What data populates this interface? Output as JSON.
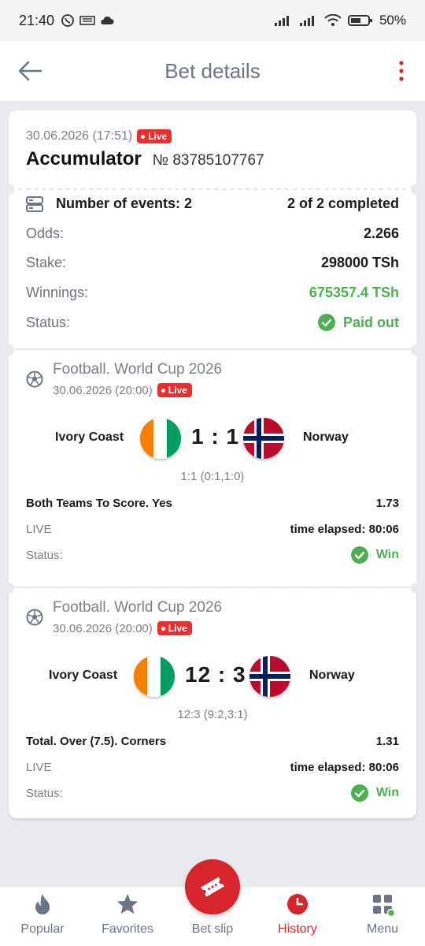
{
  "status_bar": {
    "time": "21:40",
    "battery": "50%"
  },
  "header": {
    "title": "Bet details"
  },
  "bet": {
    "date": "30.06.2026 (17:51)",
    "live_badge": "Live",
    "type": "Accumulator",
    "number": "№ 83785107767",
    "events_label": "Number of events: 2",
    "completed": "2 of 2 completed",
    "odds_label": "Odds:",
    "odds": "2.266",
    "stake_label": "Stake:",
    "stake": "298000 TSh",
    "winnings_label": "Winnings:",
    "winnings": "675357.4 TSh",
    "status_label": "Status:",
    "status": "Paid out"
  },
  "events": [
    {
      "tournament": "Football. World Cup 2026",
      "date": "30.06.2026 (20:00)",
      "live_badge": "Live",
      "home": "Ivory Coast",
      "away": "Norway",
      "score": "1 : 1",
      "score_detail": "1:1 (0:1,1:0)",
      "market": "Both Teams To Score. Yes",
      "odds": "1.73",
      "state": "LIVE",
      "elapsed": "time elapsed: 80:06",
      "status_label": "Status:",
      "status": "Win"
    },
    {
      "tournament": "Football. World Cup 2026",
      "date": "30.06.2026 (20:00)",
      "live_badge": "Live",
      "home": "Ivory Coast",
      "away": "Norway",
      "score": "12 : 3",
      "score_detail": "12:3 (9:2,3:1)",
      "market": "Total. Over (7.5). Corners",
      "odds": "1.31",
      "state": "LIVE",
      "elapsed": "time elapsed: 80:06",
      "status_label": "Status:",
      "status": "Win"
    }
  ],
  "nav": {
    "popular": "Popular",
    "favorites": "Favorites",
    "betslip": "Bet slip",
    "history": "History",
    "menu": "Menu"
  },
  "colors": {
    "accent_red": "#d6252b",
    "success_green": "#4caf50",
    "live_red": "#e8312f"
  }
}
